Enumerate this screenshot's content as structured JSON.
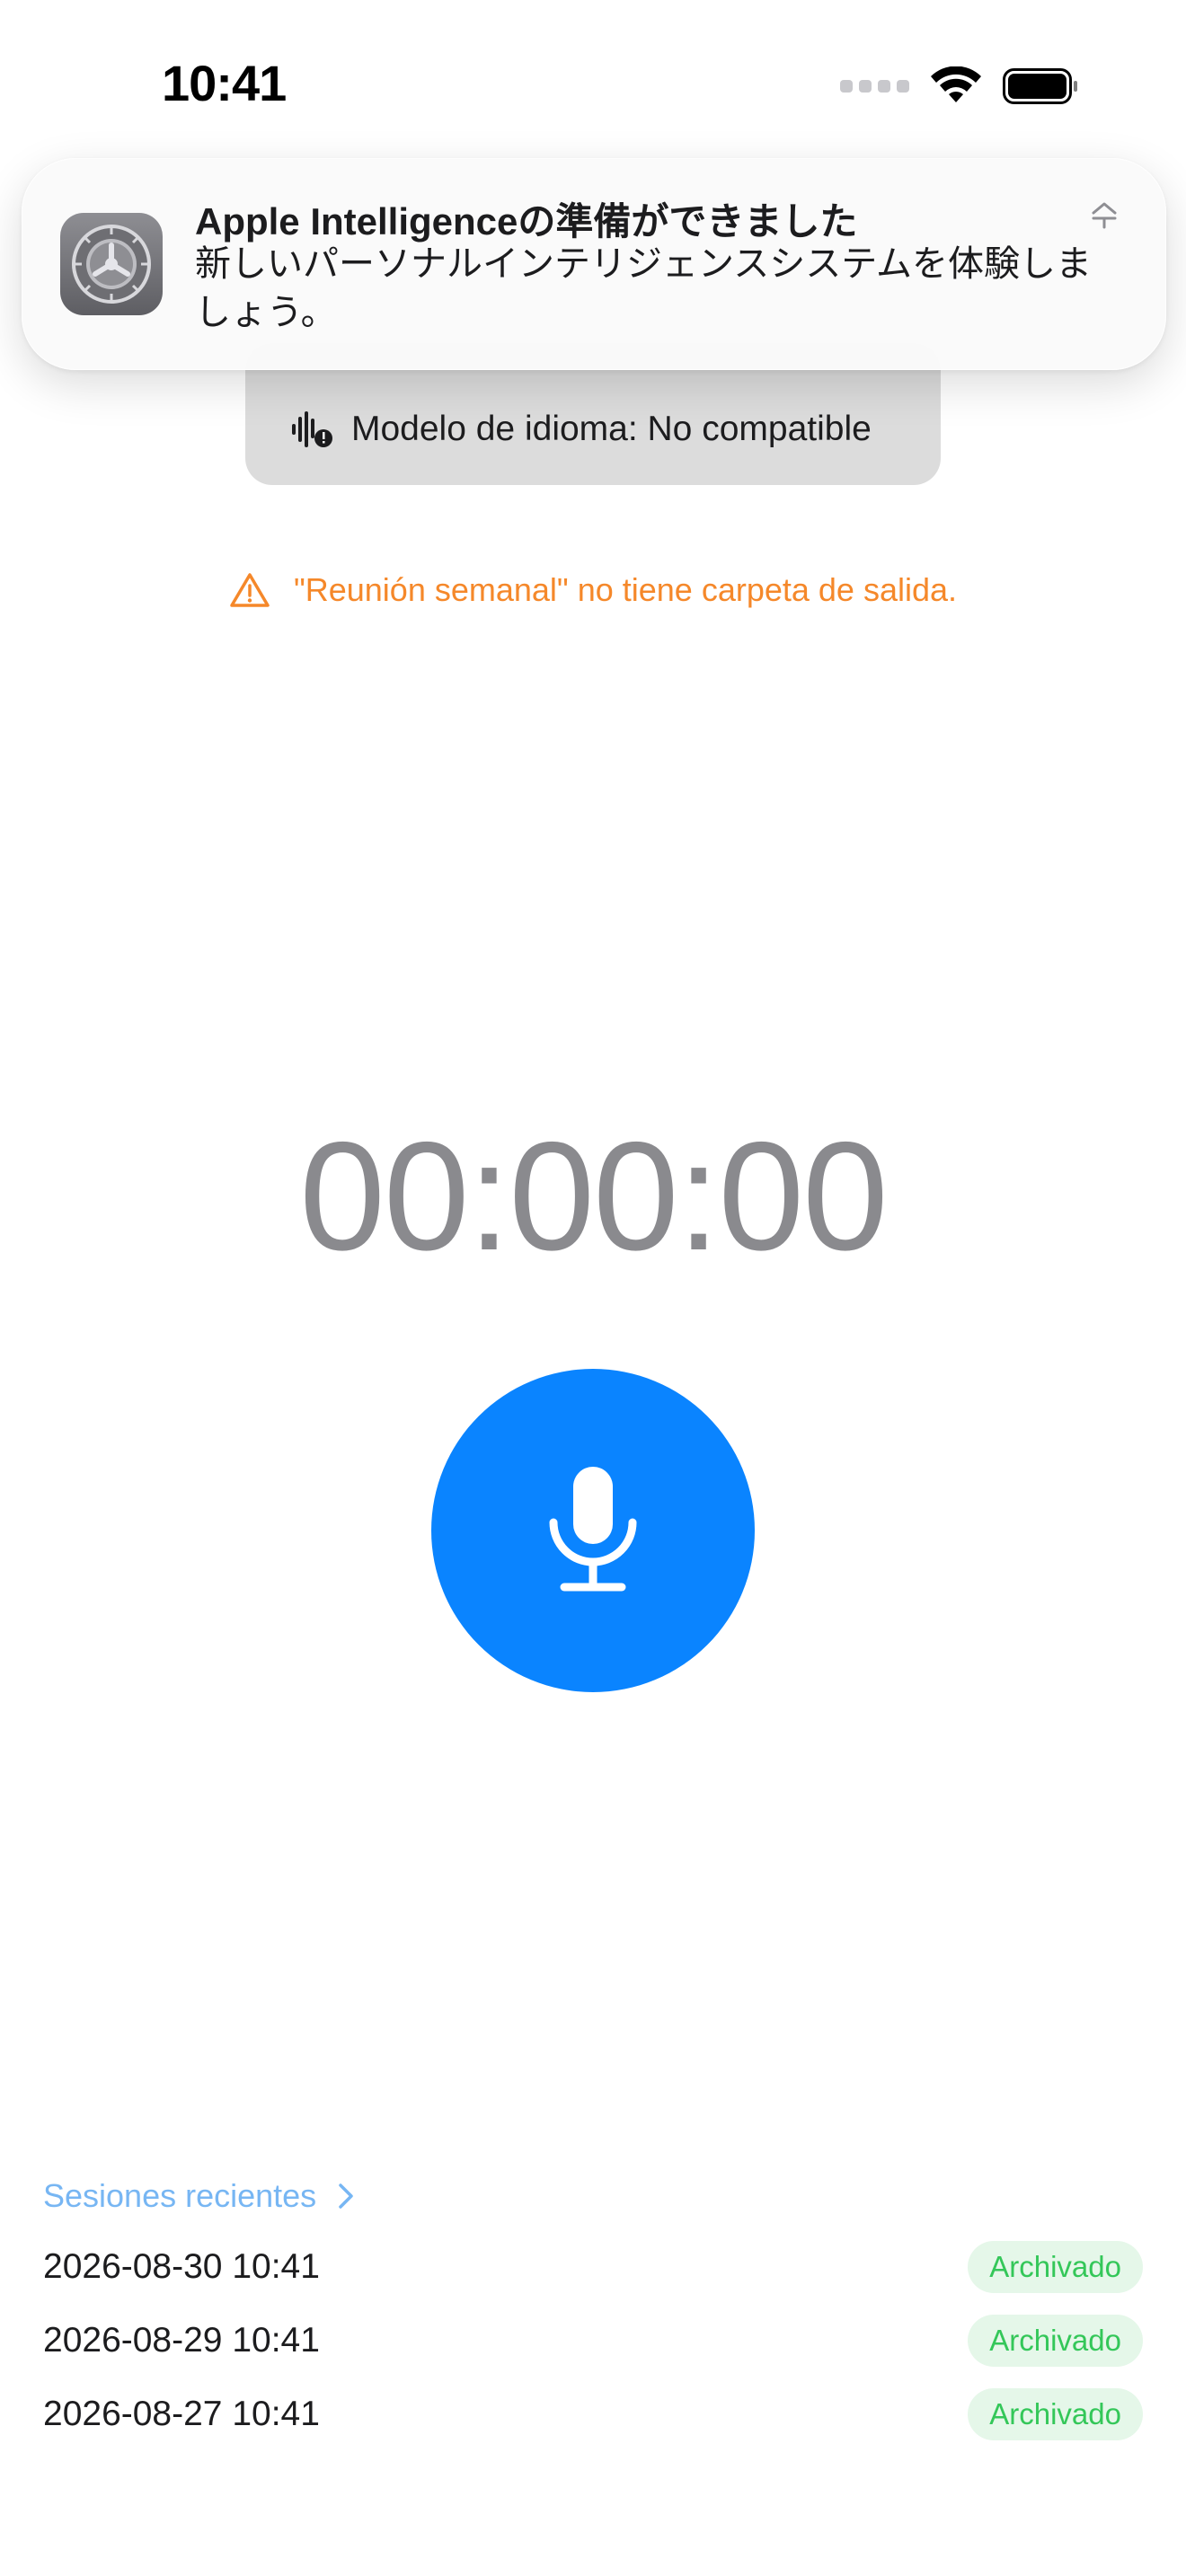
{
  "status_bar": {
    "time": "10:41"
  },
  "notification": {
    "app_icon": "settings-gear-icon",
    "title": "Apple Intelligenceの準備ができました",
    "body": "新しいパーソナルインテリジェンスシステムを体験しましょう。"
  },
  "model_status": {
    "icon": "waveform-alert-icon",
    "label": "Modelo de idioma: No compatible"
  },
  "warning": {
    "icon": "warning-triangle-icon",
    "text": "\"Reunión semanal\" no tiene carpeta de salida.",
    "color": "#f5882a"
  },
  "timer": {
    "value": "00:00:00"
  },
  "record_button": {
    "icon": "microphone-icon",
    "color": "#0a84ff"
  },
  "recent_sessions": {
    "title": "Sesiones recientes",
    "items": [
      {
        "date": "2026-08-30 10:41",
        "status": "Archivado"
      },
      {
        "date": "2026-08-29 10:41",
        "status": "Archivado"
      },
      {
        "date": "2026-08-27 10:41",
        "status": "Archivado"
      }
    ]
  }
}
